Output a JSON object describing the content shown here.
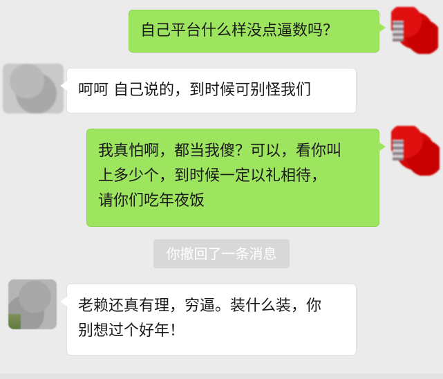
{
  "chat": {
    "messages": [
      {
        "side": "sent",
        "text": "自己平台什么样没点逼数吗？",
        "avatar": "red-blurred-avatar"
      },
      {
        "side": "received",
        "text": "呵呵 自己说的，到时候可别怪我们",
        "avatar": "gray-blurred-avatar"
      },
      {
        "side": "sent",
        "text_lines": [
          "我真怕啊，都当我傻？可以，看你叫",
          "上多少个，到时候一定以礼相待，",
          "请你们吃年夜饭"
        ],
        "avatar": "red-blurred-avatar"
      },
      {
        "side": "system",
        "text": "你撤回了一条消息"
      },
      {
        "side": "received",
        "text_lines": [
          "老赖还真有理，穷逼。装什么装，你",
          "别想过个好年！"
        ],
        "avatar": "gray-blurred-avatar"
      }
    ]
  }
}
